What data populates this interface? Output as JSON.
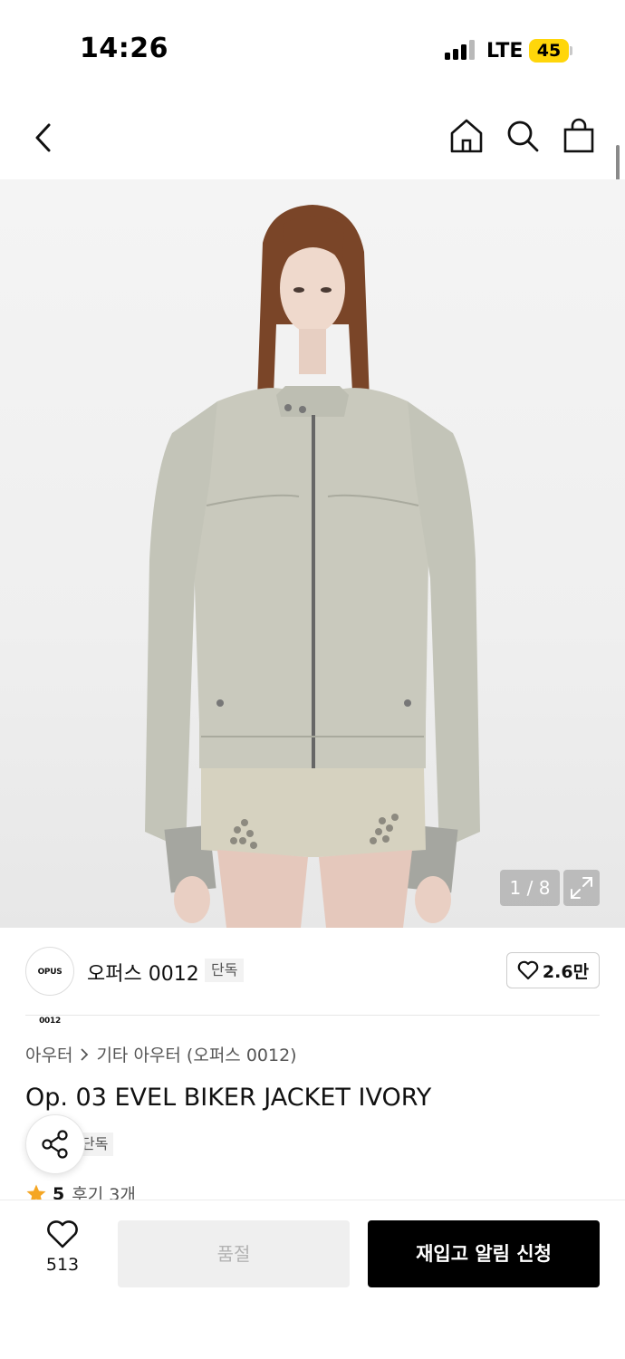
{
  "status_bar": {
    "time": "14:26",
    "network": "LTE",
    "battery": "45"
  },
  "nav": {
    "back_icon": "chevron-left-icon",
    "home_icon": "home-icon",
    "search_icon": "search-icon",
    "bag_icon": "shopping-bag-icon"
  },
  "gallery": {
    "counter": "1 / 8",
    "expand_icon": "expand-icon"
  },
  "brand": {
    "logo_text": "OPUS 0012",
    "name": "오퍼스 0012",
    "tag": "단독",
    "likes": "2.6만"
  },
  "product": {
    "breadcrumb": [
      "아우터",
      "기타 아우터 (오퍼스 0012)"
    ],
    "title": "Op. 03 EVEL BIKER JACKET IVORY",
    "tag": "단독",
    "rating": "5",
    "reviews": "후기 3개"
  },
  "bottom_bar": {
    "wish_count": "513",
    "soldout_label": "품절",
    "restock_label": "재입고 알림 신청"
  },
  "colors": {
    "accent_star": "#f5a623",
    "primary_button": "#000000",
    "disabled_button": "#efefef"
  }
}
